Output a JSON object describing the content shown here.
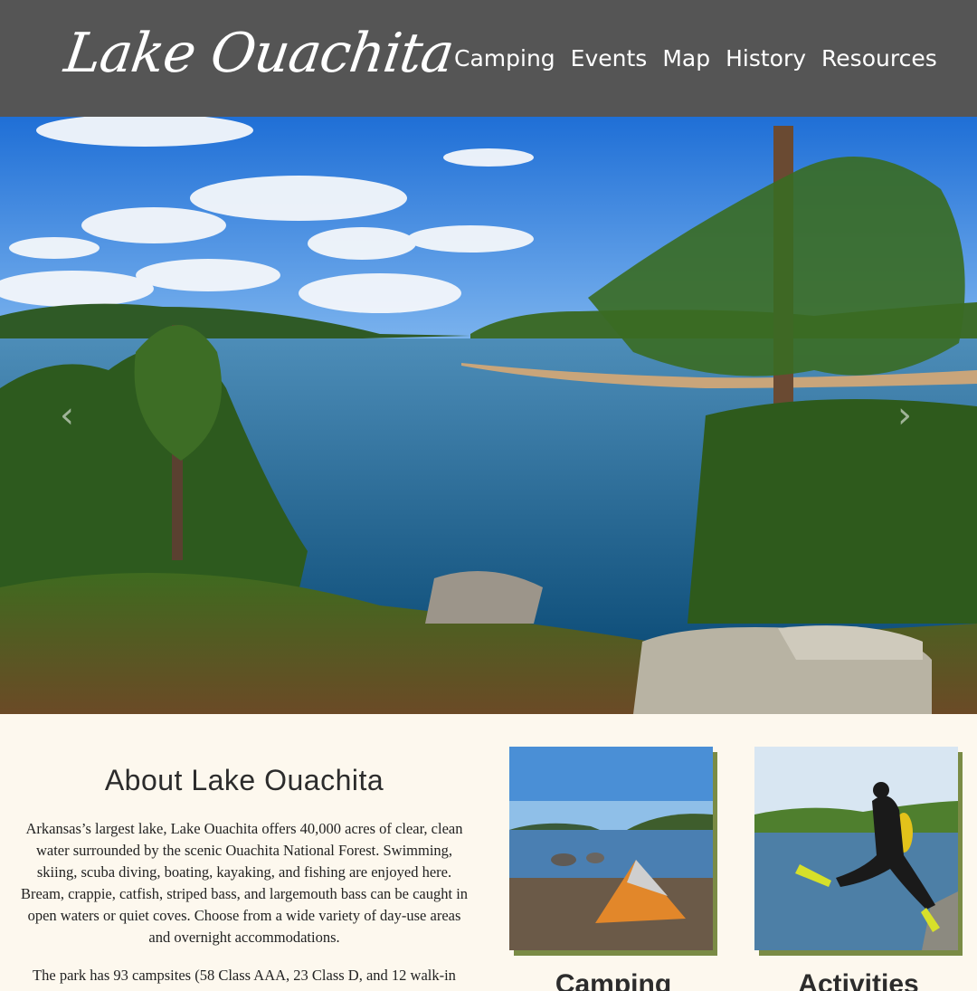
{
  "header": {
    "logo_text": "Lake Ouachita",
    "nav": [
      {
        "label": "Camping"
      },
      {
        "label": "Events"
      },
      {
        "label": "Map"
      },
      {
        "label": "History"
      },
      {
        "label": "Resources"
      }
    ]
  },
  "hero": {
    "prev_icon": "chevron-left-icon",
    "next_icon": "chevron-right-icon"
  },
  "about": {
    "title": "About Lake Ouachita",
    "paragraph1": "Arkansas’s largest lake, Lake Ouachita offers 40,000 acres of clear, clean water surrounded by the scenic Ouachita National Forest. Swimming, skiing, scuba diving, boating, kayaking, and fishing are enjoyed here. Bream, crappie, catfish, striped bass, and largemouth bass can be caught in open waters or quiet coves. Choose from a wide variety of day-use areas and overnight accommodations.",
    "paragraph2": "The park has 93 campsites (58 Class AAA, 23 Class D, and 12 walk-in"
  },
  "cards": [
    {
      "title": "Camping"
    },
    {
      "title": "Activities"
    }
  ],
  "colors": {
    "header_bg": "#555555",
    "page_bg": "#fdf8ee",
    "card_accent": "#7a8b45"
  }
}
